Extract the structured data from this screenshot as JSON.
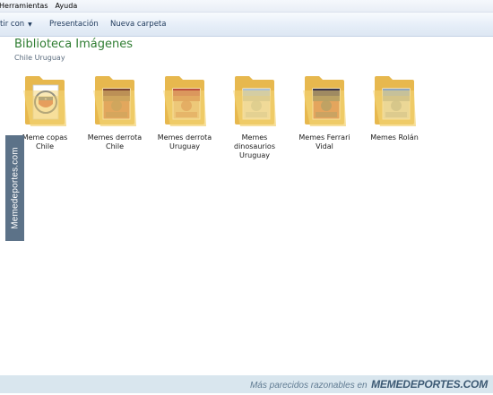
{
  "menubar": {
    "items": [
      "Herramientas",
      "Ayuda"
    ]
  },
  "toolbar": {
    "share": "tir con",
    "presentation": "Presentación",
    "new_folder": "Nueva carpeta"
  },
  "library": {
    "title": "Biblioteca Imágenes",
    "subtitle": "Chile Uruguay"
  },
  "folders": [
    {
      "name": "Meme copas\nChile",
      "thumb": "chile-crest"
    },
    {
      "name": "Memes derrota\nChile",
      "thumb": "photo"
    },
    {
      "name": "Memes derrota\nUruguay",
      "thumb": "photo"
    },
    {
      "name": "Memes\ndinosaurios\nUruguay",
      "thumb": "photo"
    },
    {
      "name": "Memes Ferrari\nVidal",
      "thumb": "photo"
    },
    {
      "name": "Memes Rolán",
      "thumb": "photo"
    }
  ],
  "watermark": {
    "side_text": "Memedeportes.com",
    "bottom_prefix": "Más parecidos razonables en",
    "bottom_brand": "MEMEDEPORTES.COM"
  },
  "colors": {
    "library_title": "#2f7d32",
    "folder": "#f2cf6b",
    "watermark_bg": "#5c7288",
    "bottom_bar": "#d9e6ee"
  }
}
